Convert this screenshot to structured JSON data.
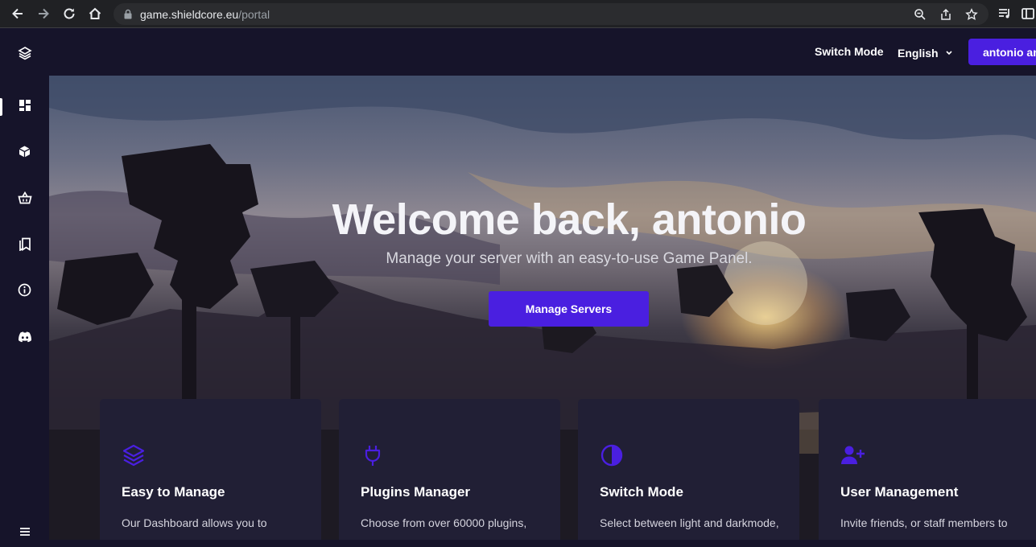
{
  "browser": {
    "url_host": "game.shieldcore.eu",
    "url_path": "/portal"
  },
  "topbar": {
    "switch_mode": "Switch Mode",
    "language": "English",
    "user_button": "antonio antonio"
  },
  "sidebar": {
    "items": [
      {
        "icon": "layers-icon"
      },
      {
        "icon": "dashboard-icon",
        "active": true
      },
      {
        "icon": "box-icon"
      },
      {
        "icon": "basket-icon"
      },
      {
        "icon": "bookmarks-icon"
      },
      {
        "icon": "info-icon"
      },
      {
        "icon": "discord-icon"
      },
      {
        "icon": "menu-icon"
      }
    ]
  },
  "hero": {
    "title": "Welcome back, antonio",
    "subtitle": "Manage your server with an easy-to-use Game Panel.",
    "button": "Manage Servers"
  },
  "features": [
    {
      "icon": "layers-icon",
      "title": "Easy to Manage",
      "desc": "Our Dashboard allows you to"
    },
    {
      "icon": "plug-icon",
      "title": "Plugins Manager",
      "desc": "Choose from over 60000 plugins,"
    },
    {
      "icon": "contrast-icon",
      "title": "Switch Mode",
      "desc": "Select between light and darkmode,"
    },
    {
      "icon": "user-plus-icon",
      "title": "User Management",
      "desc": "Invite friends, or staff members to"
    }
  ],
  "colors": {
    "accent": "#4a1fe0",
    "background": "#16142a",
    "card": "#211f35"
  }
}
